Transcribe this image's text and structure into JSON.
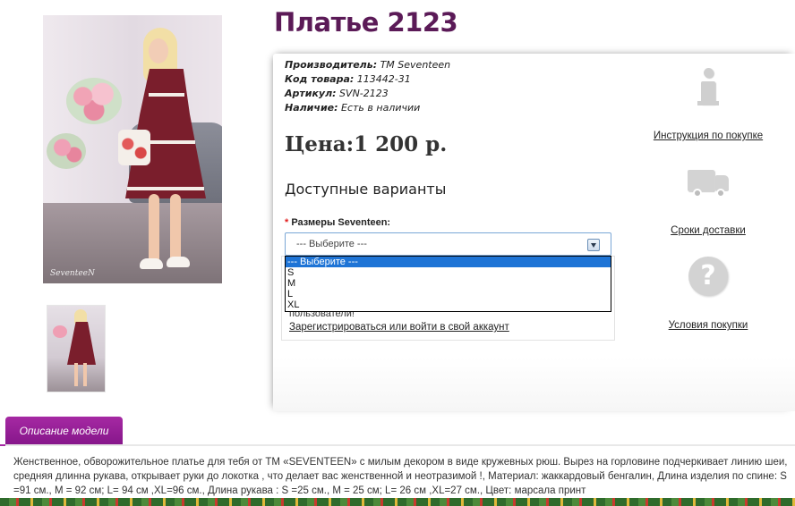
{
  "product": {
    "title": "Платье 2123",
    "image_watermark": "SeventeeN",
    "specs": [
      {
        "label": "Производитель:",
        "value": " TM Seventeen"
      },
      {
        "label": "Код товара:",
        "value": " 113442-31"
      },
      {
        "label": "Артикул:",
        "value": " SVN-2123"
      },
      {
        "label": "Наличие:",
        "value": " Есть в наличии"
      }
    ],
    "price_label": "Цена:",
    "price_value": "1 200 р."
  },
  "options": {
    "heading": "Доступные варианты",
    "required_mark": "*",
    "size_label": "Размеры Seventeen:",
    "selected": "--- Выберите ---",
    "choices": [
      "--- Выберите ---",
      "S",
      "M",
      "L",
      "XL"
    ]
  },
  "login": {
    "text": "пользователи!",
    "link": "Зарегистрироваться или войти в свой аккаунт"
  },
  "side_links": {
    "instructions": "Инструкция по покупке",
    "delivery": "Сроки доставки",
    "conditions": "Условия покупки"
  },
  "icons": {
    "instructions": "info-icon",
    "delivery": "truck-icon",
    "conditions": "question-icon"
  },
  "description": {
    "tab_label": "Описание модели",
    "text": "Женственное, обворожительное платье для тебя от ТМ «SEVENTEEN» с милым декором в виде кружевных рюш. Вырез на горловине подчеркивает линию шеи, средняя длинна рукава, открывает руки до локотка , что делает вас женственной и неотразимой !, Материал: жаккардовый бенгалин, Длина изделия по спине: S =91 см., M = 92 см; L= 94 см ,XL=96 см., Длина рукава : S =25 см., M = 25 см; L= 26 см ,XL=27 см., Цвет: марсала принт"
  },
  "colors": {
    "title": "#5b1a57",
    "tab": "#a629a3",
    "dress": "#7a1e2c",
    "selection": "#1e74d6"
  }
}
